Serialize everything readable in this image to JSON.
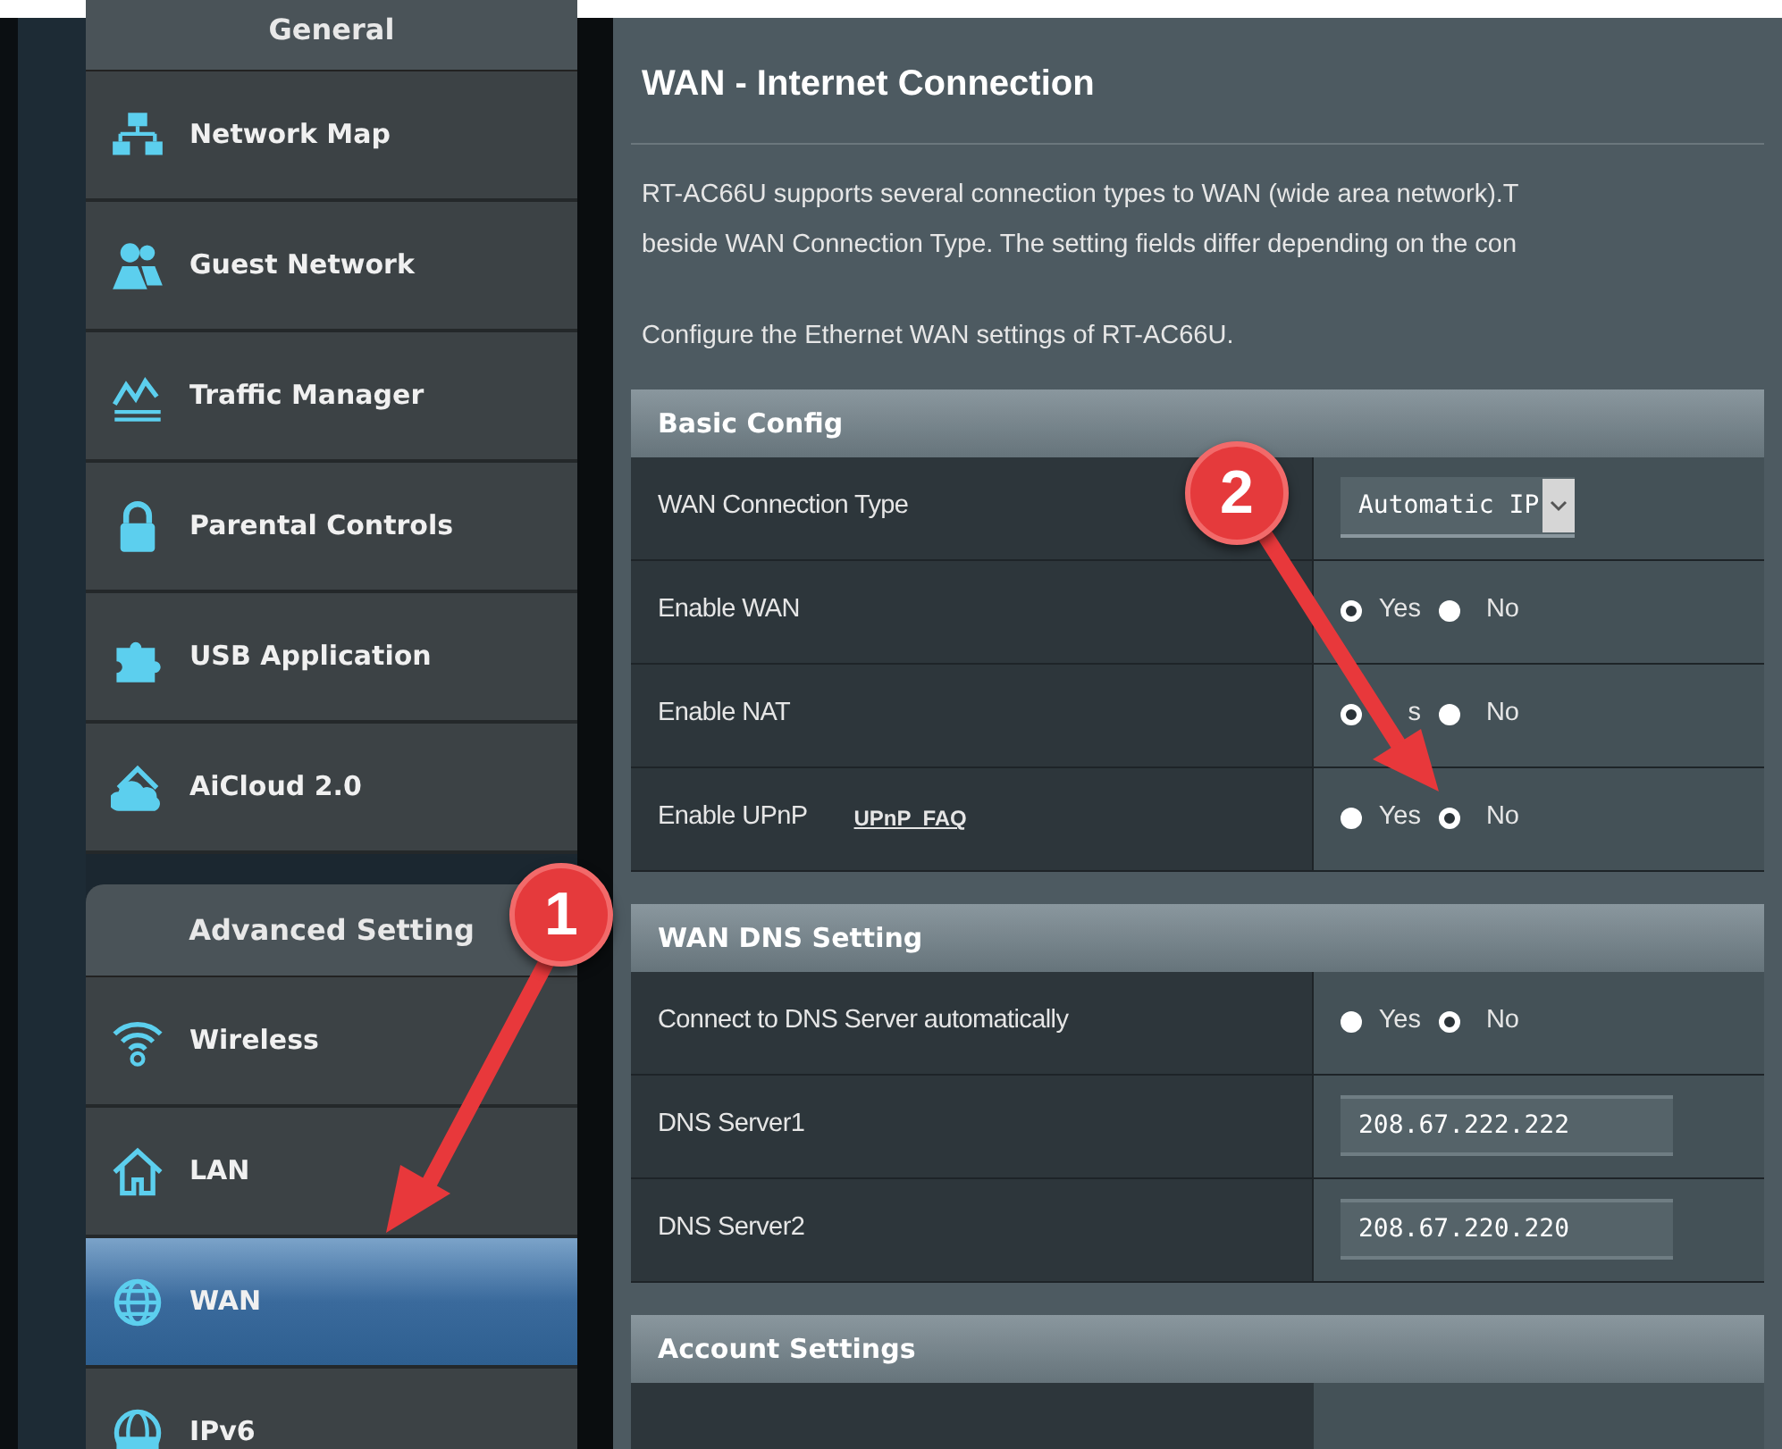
{
  "sidebar": {
    "sections": [
      {
        "title": "General",
        "items": [
          {
            "label": "Network Map",
            "selected": false
          },
          {
            "label": "Guest Network",
            "selected": false
          },
          {
            "label": "Traffic Manager",
            "selected": false
          },
          {
            "label": "Parental Controls",
            "selected": false
          },
          {
            "label": "USB Application",
            "selected": false
          },
          {
            "label": "AiCloud 2.0",
            "selected": false
          }
        ]
      },
      {
        "title": "Advanced Setting",
        "items": [
          {
            "label": "Wireless",
            "selected": false
          },
          {
            "label": "LAN",
            "selected": false
          },
          {
            "label": "WAN",
            "selected": true
          },
          {
            "label": "IPv6",
            "selected": false
          }
        ]
      }
    ]
  },
  "page": {
    "title": "WAN - Internet Connection",
    "description": [
      "RT-AC66U supports several connection types to WAN (wide area network).T",
      "beside WAN Connection Type. The setting fields differ depending on the con"
    ],
    "note": "Configure the Ethernet WAN settings of RT-AC66U."
  },
  "sections": [
    {
      "title": "Basic Config",
      "rows": [
        {
          "label": "WAN Connection Type",
          "kind": "select",
          "value": "Automatic IP"
        },
        {
          "label": "Enable WAN",
          "kind": "radio",
          "options": [
            {
              "label": "Yes",
              "selected": true
            },
            {
              "label": "No",
              "selected": false
            }
          ]
        },
        {
          "label": "Enable NAT",
          "kind": "radio",
          "options": [
            {
              "label": "s",
              "selected": true
            },
            {
              "label": "No",
              "selected": false
            }
          ]
        },
        {
          "label": "Enable UPnP",
          "link": "UPnP  FAQ",
          "kind": "radio",
          "options": [
            {
              "label": "Yes",
              "selected": false
            },
            {
              "label": "No",
              "selected": true
            }
          ]
        }
      ]
    },
    {
      "title": "WAN DNS Setting",
      "rows": [
        {
          "label": "Connect to DNS Server automatically",
          "kind": "radio",
          "options": [
            {
              "label": "Yes",
              "selected": false
            },
            {
              "label": "No",
              "selected": true
            }
          ]
        },
        {
          "label": "DNS Server1",
          "kind": "text",
          "value": "208.67.222.222"
        },
        {
          "label": "DNS Server2",
          "kind": "text",
          "value": "208.67.220.220"
        }
      ]
    },
    {
      "title": "Account Settings"
    }
  ],
  "annotations": [
    {
      "label": "1"
    },
    {
      "label": "2"
    }
  ]
}
